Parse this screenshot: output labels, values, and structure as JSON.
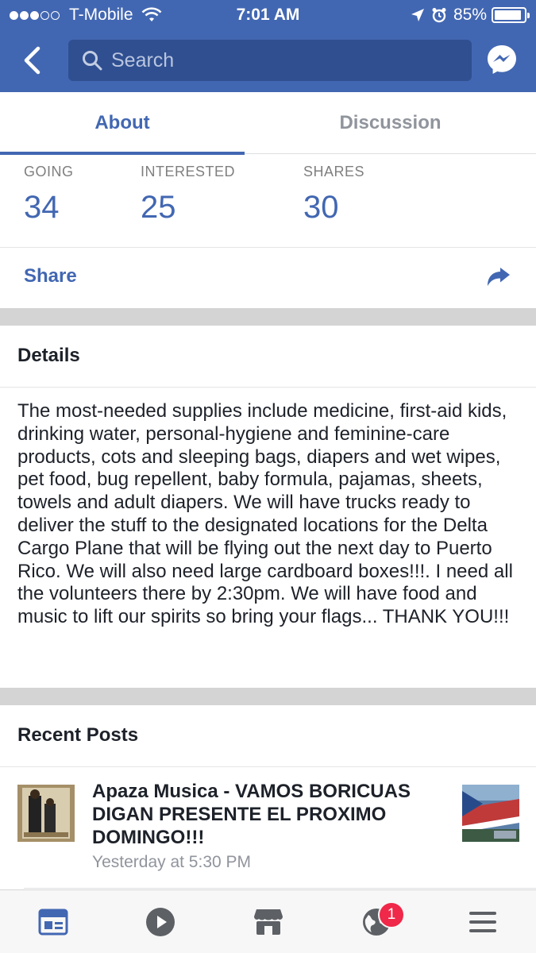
{
  "status_bar": {
    "carrier": "T-Mobile",
    "time": "7:01 AM",
    "battery": "85%"
  },
  "header": {
    "search_placeholder": "Search"
  },
  "tabs": [
    {
      "label": "About",
      "active": true
    },
    {
      "label": "Discussion",
      "active": false
    }
  ],
  "stats": {
    "going_label": "GOING",
    "going_value": "34",
    "interested_label": "INTERESTED",
    "interested_value": "25",
    "shares_label": "SHARES",
    "shares_value": "30"
  },
  "share": {
    "label": "Share"
  },
  "details": {
    "heading": "Details",
    "body": "The most-needed supplies include medicine, first-aid kids, drinking water, personal-hygiene and feminine-care products, cots and sleeping bags, diapers and wet wipes, pet food, bug repellent, baby formula, pajamas, sheets, towels and adult diapers. We will have trucks ready to deliver the stuff to the designated locations for the Delta Cargo Plane that will be flying out the next day to Puerto Rico. We will also need large cardboard boxes!!!. I need all the volunteers there by 2:30pm. We will have food and music to lift our spirits so bring your flags... THANK YOU!!!"
  },
  "recent_posts": {
    "heading": "Recent Posts",
    "items": [
      {
        "title": "Apaza Musica - VAMOS BORICUAS DIGAN PRESENTE EL PROXIMO DOMINGO!!!",
        "time": "Yesterday at 5:30 PM"
      }
    ]
  },
  "bottom_nav": {
    "items": [
      "news-feed-icon",
      "video-icon",
      "marketplace-icon",
      "notifications-globe-icon",
      "menu-icon"
    ],
    "notification_badge": "1"
  },
  "colors": {
    "brand": "#4267b2",
    "badge": "#f02849",
    "muted": "#90949c"
  }
}
